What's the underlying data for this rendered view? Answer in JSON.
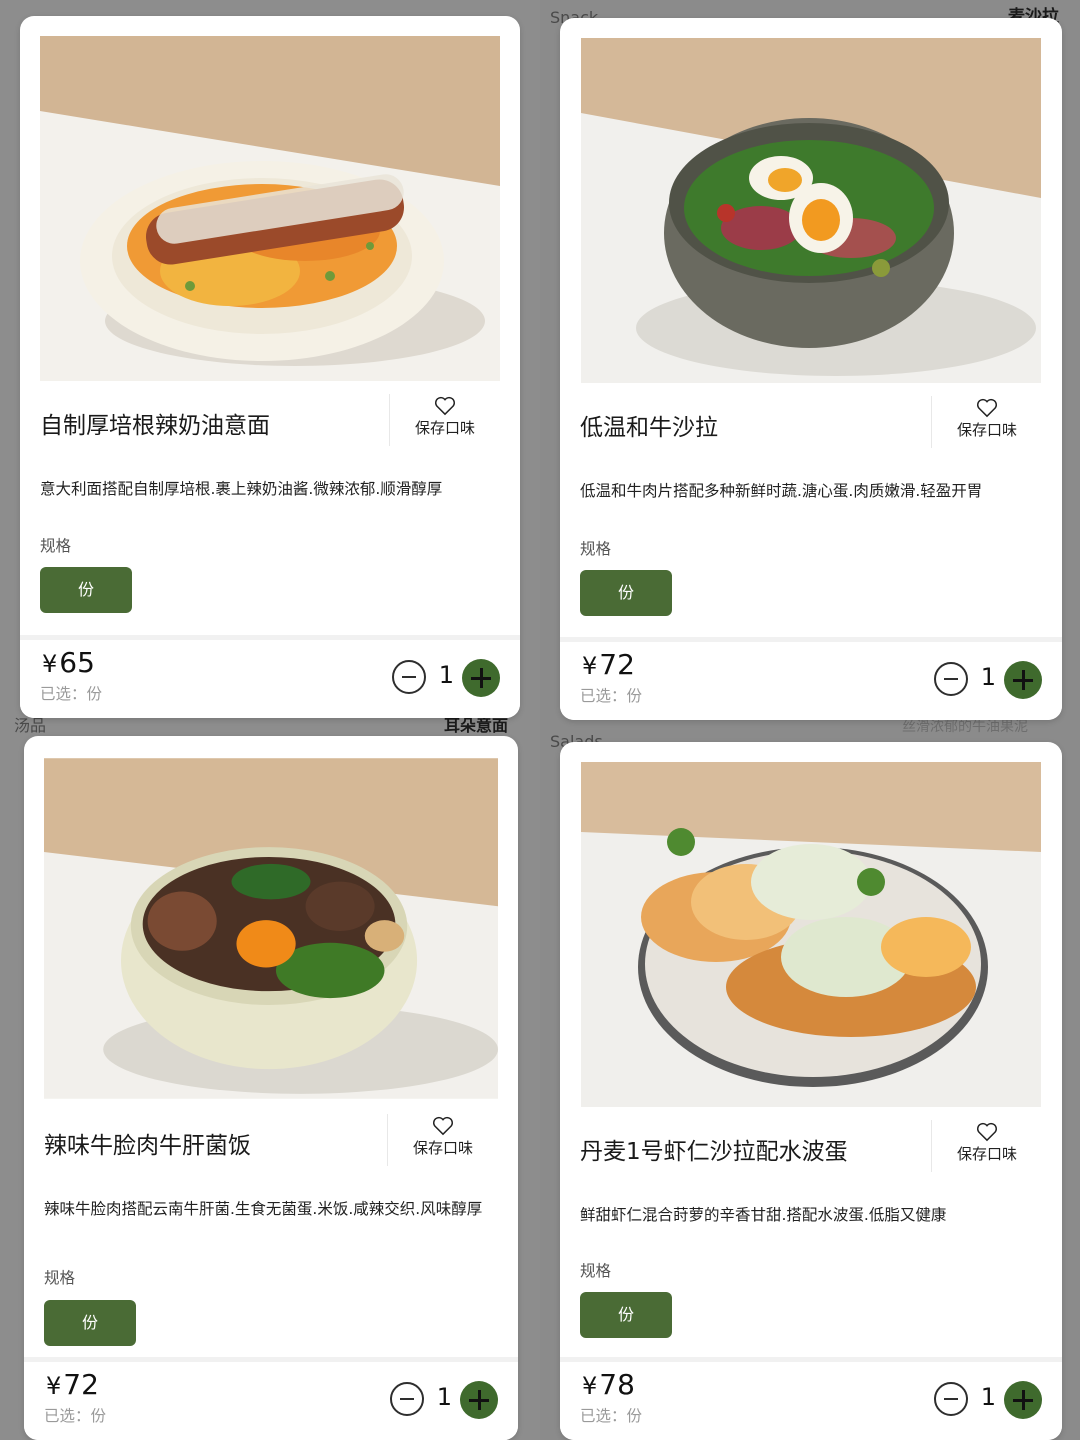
{
  "background": {
    "fragments": [
      "Snack",
      "麦沙拉",
      "汤品",
      "耳朵意面",
      "Salads",
      "丝滑浓郁的牛油果泥"
    ]
  },
  "common": {
    "save_label": "保存口味",
    "spec_label": "规格",
    "spec_option": "份",
    "selected_text": "已选：份",
    "currency": "¥",
    "quantity": "1"
  },
  "cards": [
    {
      "title": "自制厚培根辣奶油意面",
      "description": "意大利面搭配自制厚培根.裹上辣奶油酱.微辣浓郁.顺滑醇厚",
      "price": "65"
    },
    {
      "title": "低温和牛沙拉",
      "description": "低温和牛肉片搭配多种新鲜时蔬.溏心蛋.肉质嫩滑.轻盈开胃",
      "price": "72"
    },
    {
      "title": "辣味牛脸肉牛肝菌饭",
      "description": "辣味牛脸肉搭配云南牛肝菌.生食无菌蛋.米饭.咸辣交织.风味醇厚",
      "price": "72"
    },
    {
      "title": "丹麦1号虾仁沙拉配水波蛋",
      "description": "鲜甜虾仁混合莳萝的辛香甘甜.搭配水波蛋.低脂又健康",
      "price": "78"
    }
  ],
  "colors": {
    "accent_green": "#4a6b35",
    "plus_green": "#3f6a2d"
  }
}
